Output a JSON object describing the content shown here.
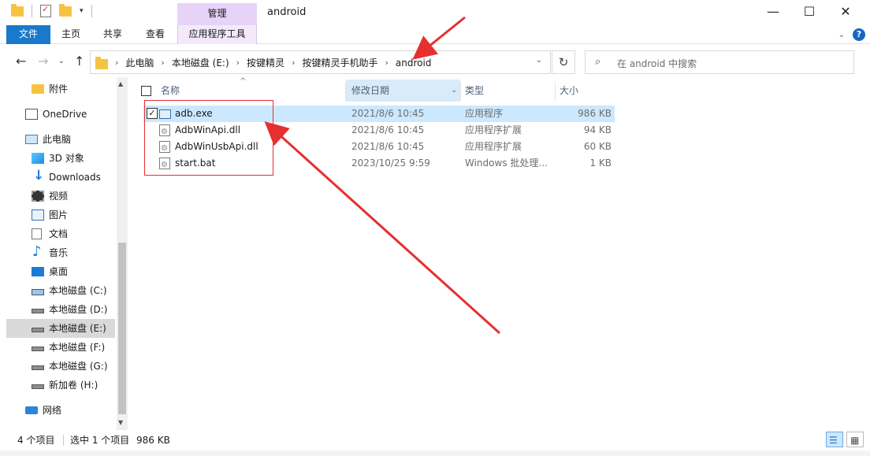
{
  "titlebar": {
    "manage_tab": "管理",
    "title": "android",
    "minimize": "—",
    "maximize": "☐",
    "close": "✕"
  },
  "ribbon": {
    "tabs": [
      "文件",
      "主页",
      "共享",
      "查看",
      "应用程序工具"
    ]
  },
  "address": {
    "crumbs": [
      "此电脑",
      "本地磁盘 (E:)",
      "按键精灵",
      "按键精灵手机助手",
      "android"
    ],
    "search_placeholder": "在 android 中搜索"
  },
  "nav": {
    "items": [
      {
        "label": "附件",
        "icon": "folder-icon"
      },
      {
        "label": "OneDrive",
        "icon": "onedrive-icon"
      },
      {
        "label": "此电脑",
        "icon": "pc-icon"
      },
      {
        "label": "3D 对象",
        "icon": "3d-objects-icon"
      },
      {
        "label": "Downloads",
        "icon": "downloads-icon"
      },
      {
        "label": "视频",
        "icon": "video-icon"
      },
      {
        "label": "图片",
        "icon": "pictures-icon"
      },
      {
        "label": "文档",
        "icon": "documents-icon"
      },
      {
        "label": "音乐",
        "icon": "music-icon"
      },
      {
        "label": "桌面",
        "icon": "desktop-icon"
      },
      {
        "label": "本地磁盘 (C:)",
        "icon": "drive-c-icon"
      },
      {
        "label": "本地磁盘 (D:)",
        "icon": "drive-icon"
      },
      {
        "label": "本地磁盘 (E:)",
        "icon": "drive-icon",
        "selected": true
      },
      {
        "label": "本地磁盘 (F:)",
        "icon": "drive-icon"
      },
      {
        "label": "本地磁盘 (G:)",
        "icon": "drive-icon"
      },
      {
        "label": "新加卷 (H:)",
        "icon": "drive-icon"
      },
      {
        "label": "网络",
        "icon": "network-icon"
      }
    ]
  },
  "columns": {
    "name": "名称",
    "modified": "修改日期",
    "type": "类型",
    "size": "大小"
  },
  "files": [
    {
      "name": "adb.exe",
      "modified": "2021/8/6 10:45",
      "type": "应用程序",
      "size": "986 KB",
      "selected": true,
      "icon": "exe-icon"
    },
    {
      "name": "AdbWinApi.dll",
      "modified": "2021/8/6 10:45",
      "type": "应用程序扩展",
      "size": "94 KB",
      "icon": "dll-icon"
    },
    {
      "name": "AdbWinUsbApi.dll",
      "modified": "2021/8/6 10:45",
      "type": "应用程序扩展",
      "size": "60 KB",
      "icon": "dll-icon"
    },
    {
      "name": "start.bat",
      "modified": "2023/10/25 9:59",
      "type": "Windows 批处理...",
      "size": "1 KB",
      "icon": "bat-icon"
    }
  ],
  "status": {
    "count": "4 个项目",
    "selection": "选中 1 个项目",
    "selection_size": "986 KB"
  },
  "colors": {
    "file_tab": "#1979ca",
    "manage_tab": "#e7d3f7",
    "selection": "#cce8ff",
    "annotation": "#e63030"
  }
}
